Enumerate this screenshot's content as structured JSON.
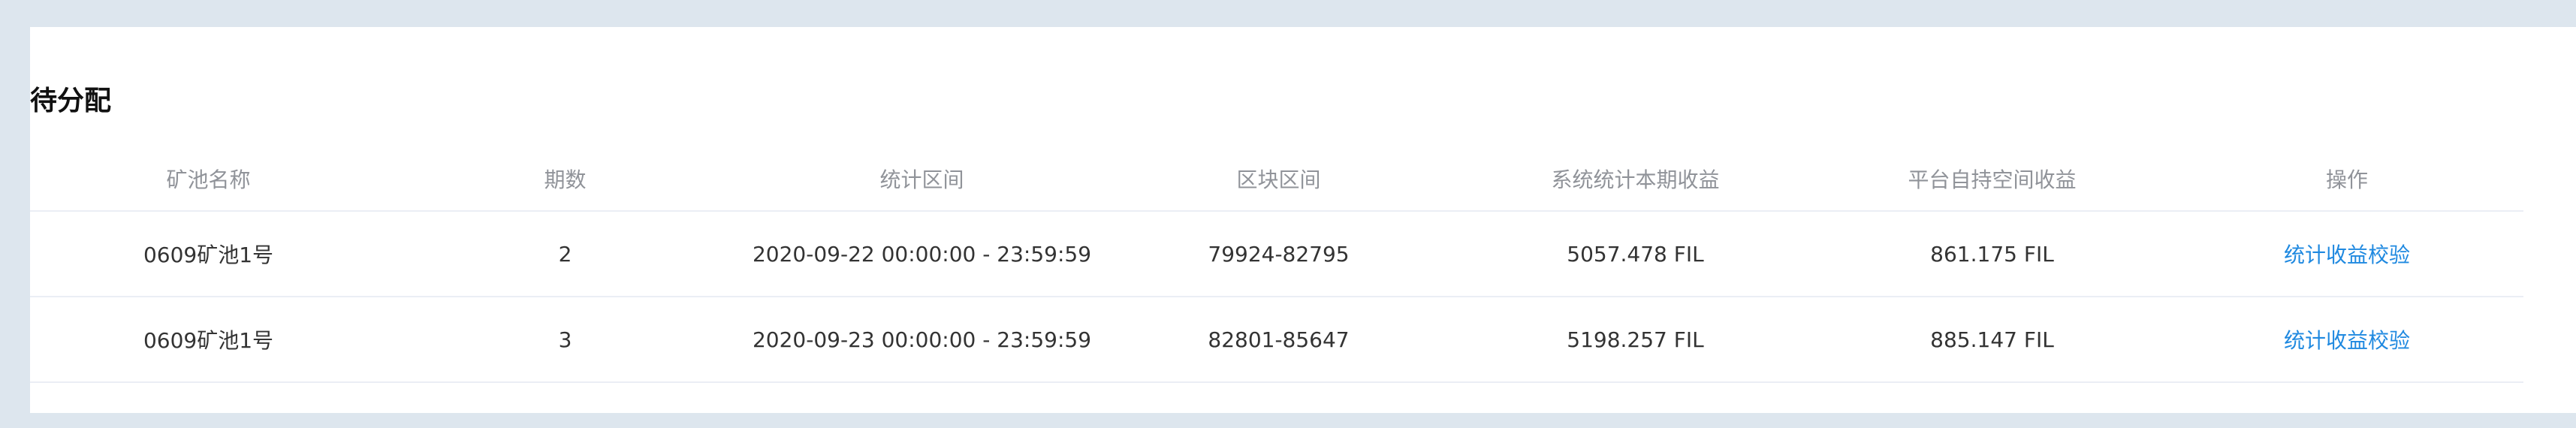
{
  "section": {
    "title": "待分配"
  },
  "table": {
    "columns": [
      "矿池名称",
      "期数",
      "统计区间",
      "区块区间",
      "系统统计本期收益",
      "平台自持空间收益",
      "操作"
    ],
    "rows": [
      {
        "pool_name": "0609矿池1号",
        "period": "2",
        "stat_range": "2020-09-22 00:00:00 - 23:59:59",
        "block_range": "79924-82795",
        "system_income": "5057.478 FIL",
        "platform_income": "861.175 FIL",
        "action": "统计收益校验"
      },
      {
        "pool_name": "0609矿池1号",
        "period": "3",
        "stat_range": "2020-09-23 00:00:00 - 23:59:59",
        "block_range": "82801-85647",
        "system_income": "5198.257 FIL",
        "platform_income": "885.147 FIL",
        "action": "统计收益校验"
      }
    ]
  }
}
